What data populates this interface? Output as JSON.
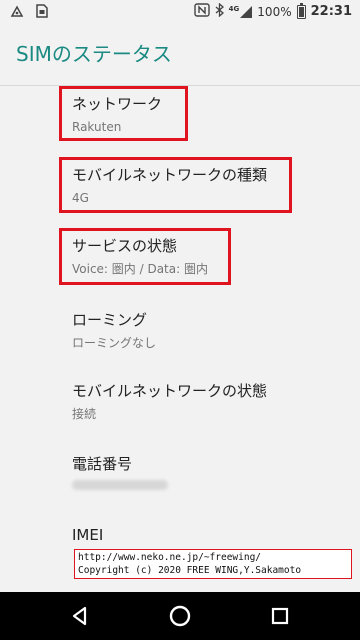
{
  "status_bar": {
    "battery_text": "100%",
    "time": "22:31",
    "network_badge": "4G",
    "icons": [
      "notification-icon",
      "sim-icon",
      "nfc-icon",
      "bluetooth-icon",
      "signal-icon",
      "battery-icon"
    ]
  },
  "toolbar": {
    "title": "SIMのステータス"
  },
  "items": [
    {
      "title": "ネットワーク",
      "summary": "Rakuten"
    },
    {
      "title": "モバイルネットワークの種類",
      "summary": "4G"
    },
    {
      "title": "サービスの状態",
      "summary": "Voice: 圏内 / Data: 圏内"
    },
    {
      "title": "ローミング",
      "summary": "ローミングなし"
    },
    {
      "title": "モバイルネットワークの状態",
      "summary": "接続"
    },
    {
      "title": "電話番号",
      "summary": ""
    },
    {
      "title": "IMEI",
      "summary": ""
    }
  ],
  "credit": {
    "line1": "http://www.neko.ne.jp/~freewing/",
    "line2": "Copyright (c) 2020 FREE WING,Y.Sakamoto"
  },
  "colors": {
    "accent": "#1a8a82",
    "highlight": "#e0141e",
    "navbar": "#000000"
  },
  "navbar": {
    "icons": [
      "back-icon",
      "home-icon",
      "recents-icon"
    ]
  }
}
